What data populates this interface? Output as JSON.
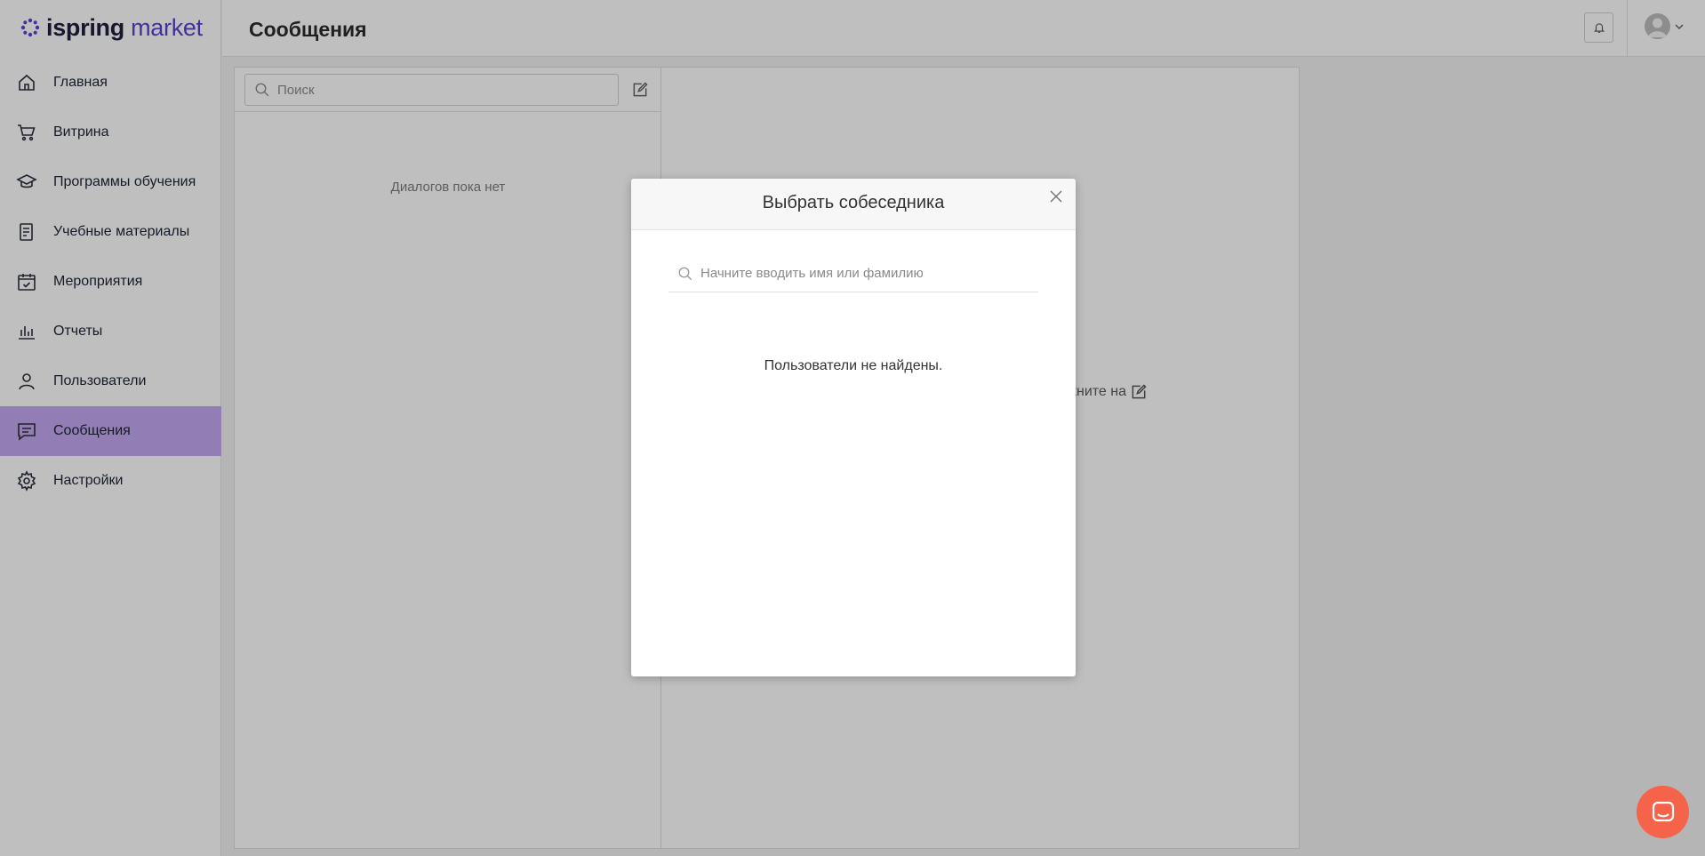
{
  "brand": {
    "part1": "ispring",
    "part2": "market",
    "accent": "#5b3fd6"
  },
  "sidebar": {
    "items": [
      {
        "label": "Главная",
        "icon": "home-icon"
      },
      {
        "label": "Витрина",
        "icon": "cart-icon"
      },
      {
        "label": "Программы обучения",
        "icon": "graduation-cap-icon"
      },
      {
        "label": "Учебные материалы",
        "icon": "document-icon"
      },
      {
        "label": "Мероприятия",
        "icon": "calendar-check-icon"
      },
      {
        "label": "Отчеты",
        "icon": "bar-chart-icon"
      },
      {
        "label": "Пользователи",
        "icon": "user-icon"
      },
      {
        "label": "Сообщения",
        "icon": "message-icon",
        "active": true
      },
      {
        "label": "Настройки",
        "icon": "gear-icon"
      }
    ],
    "active_color": "#c3a7f0"
  },
  "header": {
    "title": "Сообщения"
  },
  "messages": {
    "search_placeholder": "Поиск",
    "empty_text": "Диалогов пока нет",
    "hint_text": "кните на"
  },
  "modal": {
    "title": "Выбрать собеседника",
    "search_placeholder": "Начните вводить имя или фамилию",
    "empty_text": "Пользователи не найдены."
  },
  "chat_widget": {
    "color": "#f4634a"
  }
}
